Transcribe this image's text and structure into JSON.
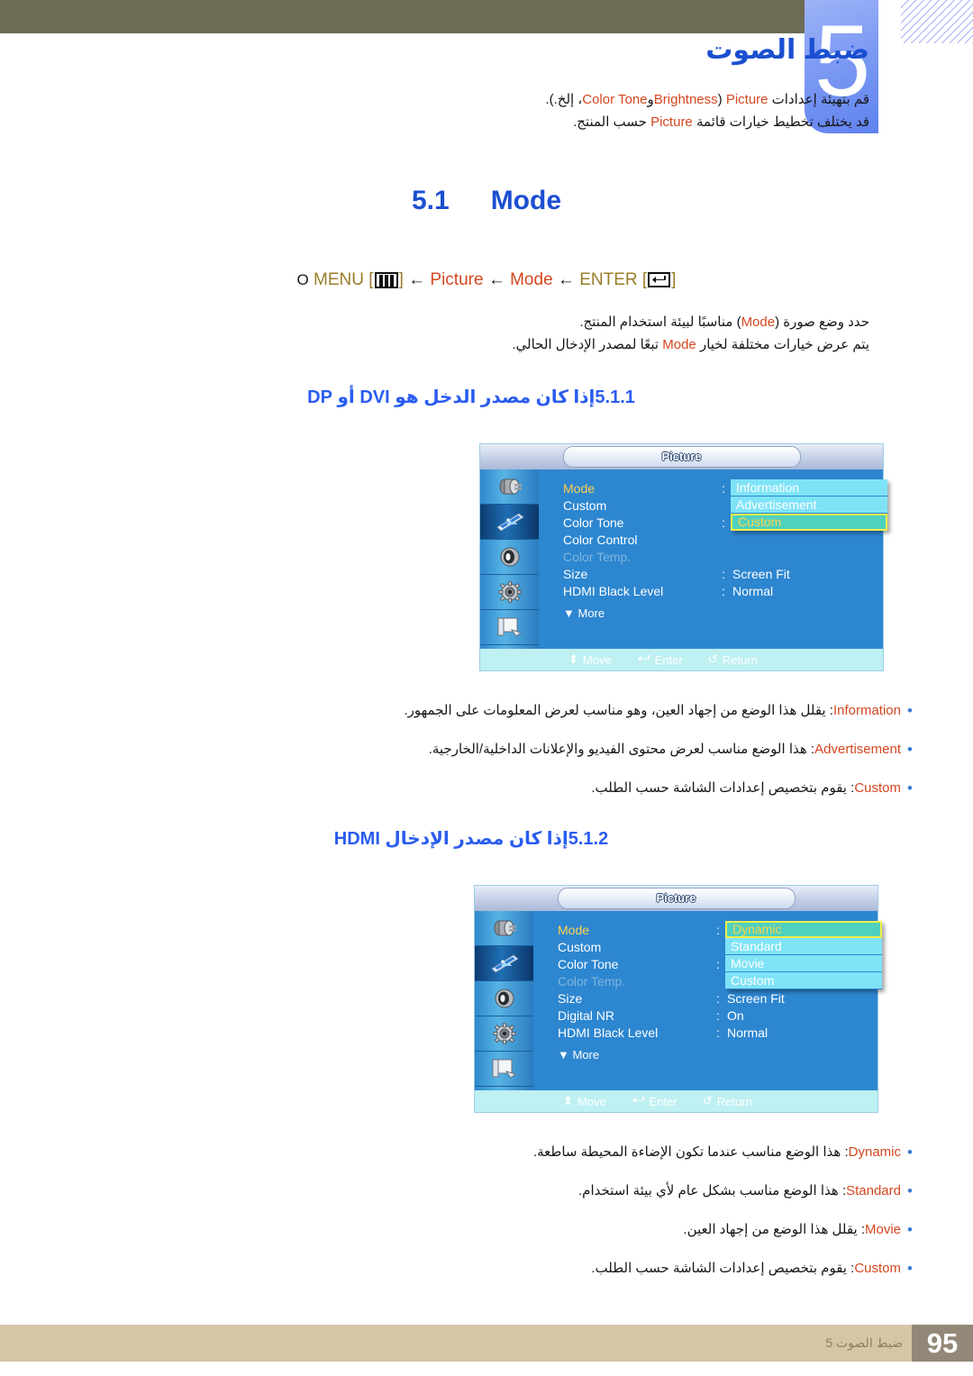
{
  "header": {
    "chapter_number": "5",
    "chapter_title": "ضبط الصوت",
    "intro_line1_pre": "قم بتهيئة إعدادات ",
    "intro_line1_picture": "Picture",
    "intro_line1_mid": " (",
    "intro_line1_brightness": "Brightness",
    "intro_line1_and": "و",
    "intro_line1_colortone": "Color Tone",
    "intro_line1_post": "، إلخ.).",
    "intro_line2_pre": "قد يختلف تخطيط خيارات قائمة ",
    "intro_line2_picture": "Picture",
    "intro_line2_post": " حسب المنتج."
  },
  "sections": {
    "s51": {
      "number": "5.1",
      "title": "Mode"
    },
    "s511": {
      "number": "5.1.1",
      "title": "إذا كان مصدر الدخل هو DVI أو DP"
    },
    "s512": {
      "number": "5.1.2",
      "title": "إذا كان مصدر الإدخال HDMI"
    }
  },
  "menu_path": {
    "circle": "O",
    "menu_label": "MENU",
    "bracket_open": "[",
    "bracket_close": "]",
    "arrow": "←",
    "picture": "Picture",
    "mode": "Mode",
    "enter_label": "ENTER"
  },
  "desc_51": {
    "line1_pre": "حدد وضع صورة (",
    "line1_mode": "Mode",
    "line1_post": ") مناسبًا لبيئة استخدام المنتج.",
    "line2_pre": "يتم عرض خيارات مختلفة لخيار ",
    "line2_mode": "Mode",
    "line2_post": " تبعًا لمصدر الإدخال الحالي."
  },
  "osd1": {
    "title": "Picture",
    "icons": [
      "input-source-icon",
      "picture-icon",
      "sound-icon",
      "setup-gear-icon",
      "multi-control-icon"
    ],
    "selected_icon_index": 1,
    "rows": [
      {
        "label": "Mode",
        "colon": ":",
        "value": "",
        "state": "active"
      },
      {
        "label": "Custom",
        "colon": "",
        "value": "",
        "state": "normal"
      },
      {
        "label": "Color Tone",
        "colon": ":",
        "value": "",
        "state": "normal"
      },
      {
        "label": "Color Control",
        "colon": "",
        "value": "",
        "state": "normal"
      },
      {
        "label": "Color Temp.",
        "colon": "",
        "value": "",
        "state": "dim"
      },
      {
        "label": "Size",
        "colon": ":",
        "value": "Screen Fit",
        "state": "normal"
      },
      {
        "label": "HDMI Black Level",
        "colon": ":",
        "value": "Normal",
        "state": "normal"
      }
    ],
    "more_label": "More",
    "dropdown": [
      {
        "label": "Information",
        "highlighted": false
      },
      {
        "label": "Advertisement",
        "highlighted": false
      },
      {
        "label": "Custom",
        "highlighted": true
      }
    ],
    "footer": [
      {
        "icon": "updown-arrow-icon",
        "label": "Move"
      },
      {
        "icon": "enter-key-icon",
        "label": "Enter"
      },
      {
        "icon": "return-arrow-icon",
        "label": "Return"
      }
    ]
  },
  "osd2": {
    "title": "Picture",
    "icons": [
      "input-source-icon",
      "picture-icon",
      "sound-icon",
      "setup-gear-icon",
      "multi-control-icon"
    ],
    "selected_icon_index": 1,
    "rows": [
      {
        "label": "Mode",
        "colon": ":",
        "value": "",
        "state": "active"
      },
      {
        "label": "Custom",
        "colon": "",
        "value": "",
        "state": "normal"
      },
      {
        "label": "Color Tone",
        "colon": ":",
        "value": "",
        "state": "normal"
      },
      {
        "label": "Color Temp.",
        "colon": "",
        "value": "",
        "state": "dim"
      },
      {
        "label": "Size",
        "colon": ":",
        "value": "Screen Fit",
        "state": "normal"
      },
      {
        "label": "Digital NR",
        "colon": ":",
        "value": "On",
        "state": "normal"
      },
      {
        "label": "HDMI Black Level",
        "colon": ":",
        "value": "Normal",
        "state": "normal"
      }
    ],
    "more_label": "More",
    "dropdown": [
      {
        "label": "Dynamic",
        "highlighted": true
      },
      {
        "label": "Standard",
        "highlighted": false
      },
      {
        "label": "Movie",
        "highlighted": false
      },
      {
        "label": "Custom",
        "highlighted": false
      }
    ],
    "footer": [
      {
        "icon": "updown-arrow-icon",
        "label": "Move"
      },
      {
        "icon": "enter-key-icon",
        "label": "Enter"
      },
      {
        "icon": "return-arrow-icon",
        "label": "Return"
      }
    ]
  },
  "bullets1": [
    {
      "term": "Information",
      "text": ": يقلل هذا الوضع من إجهاد العين، وهو مناسب لعرض المعلومات على الجمهور."
    },
    {
      "term": "Advertisement",
      "text": ": هذا الوضع مناسب لعرض محتوى الفيديو والإعلانات الداخلية/الخارجية."
    },
    {
      "term": "Custom",
      "text": ": يقوم بتخصيص إعدادات الشاشة حسب الطلب."
    }
  ],
  "bullets2": [
    {
      "term": "Dynamic",
      "text": ": هذا الوضع مناسب عندما تكون الإضاءة المحيطة ساطعة."
    },
    {
      "term": "Standard",
      "text": ": هذا الوضع مناسب بشكل عام لأي بيئة استخدام."
    },
    {
      "term": "Movie",
      "text": ": يقلل هذا الوضع من إجهاد العين."
    },
    {
      "term": "Custom",
      "text": ": يقوم بتخصيص إعدادات الشاشة حسب الطلب."
    }
  ],
  "footer": {
    "page_number": "95",
    "text": "ضبط الصوت 5"
  },
  "colors": {
    "topbar": "#6d6b56",
    "chapter_blue": "#7d9bf3",
    "heading_blue": "#1b4fd1",
    "english_term": "#d4471f",
    "menupath_gold": "#9a7d28",
    "osd_blue": "#2d86d0",
    "osd_highlight": "#4fd1bd",
    "osd_dropdown": "#7fe3f7",
    "footer_tan": "#d5c7a5",
    "footer_num_bg": "#938878"
  }
}
